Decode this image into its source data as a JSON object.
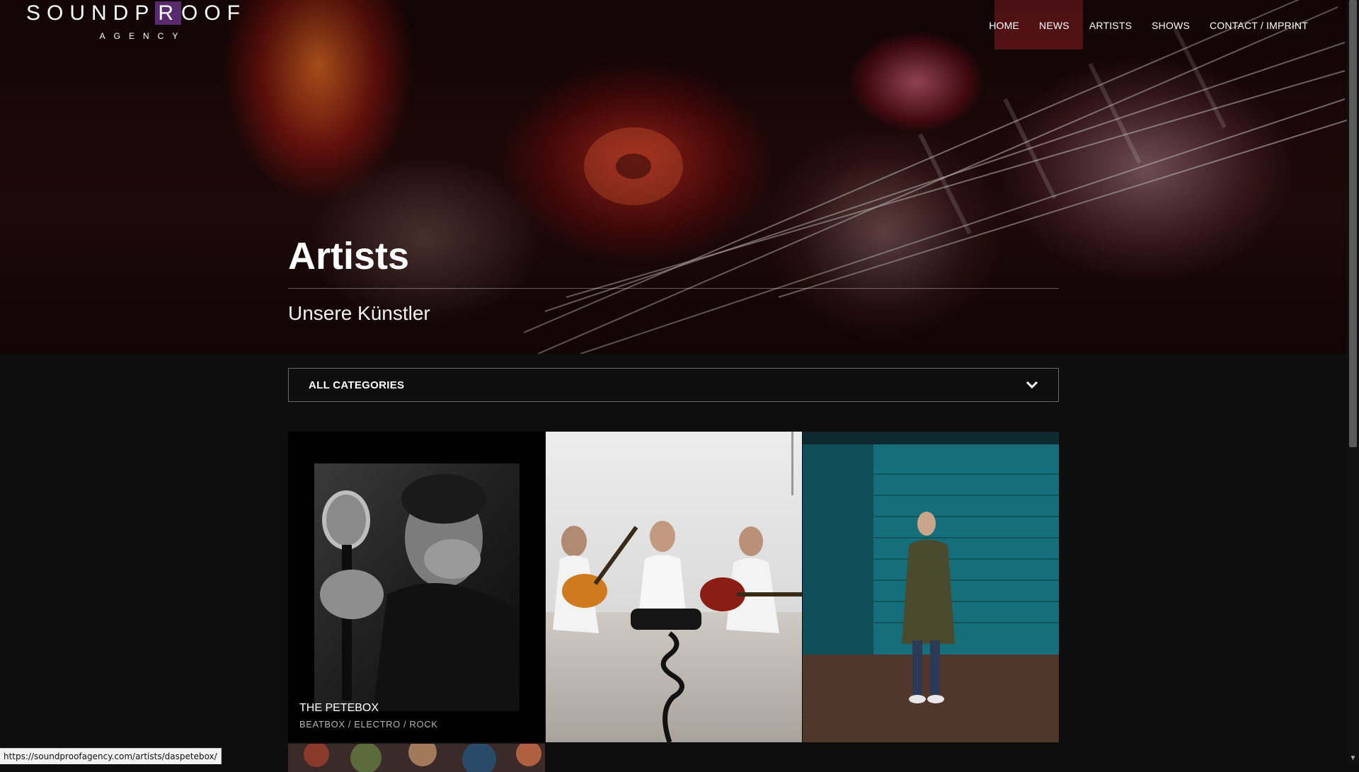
{
  "logo": {
    "prefix": "SOUNDP",
    "highlight": "R",
    "suffix": "OOF",
    "sub": "AGENCY"
  },
  "nav": {
    "items": [
      "HOME",
      "NEWS",
      "ARTISTS",
      "SHOWS",
      "CONTACT / IMPRINT"
    ]
  },
  "hero": {
    "title": "Artists",
    "subtitle": "Unsere Künstler"
  },
  "filter": {
    "selected": "ALL CATEGORIES"
  },
  "artists": [
    {
      "name": "THE PETEBOX",
      "tags": "BEATBOX / ELECTRO / ROCK"
    },
    {
      "name": "",
      "tags": ""
    },
    {
      "name": "",
      "tags": ""
    }
  ],
  "status": {
    "url": "https://soundproofagency.com/artists/daspetebox/"
  },
  "colors": {
    "brand": "#5a2a6e",
    "background": "#0e0e0e"
  }
}
